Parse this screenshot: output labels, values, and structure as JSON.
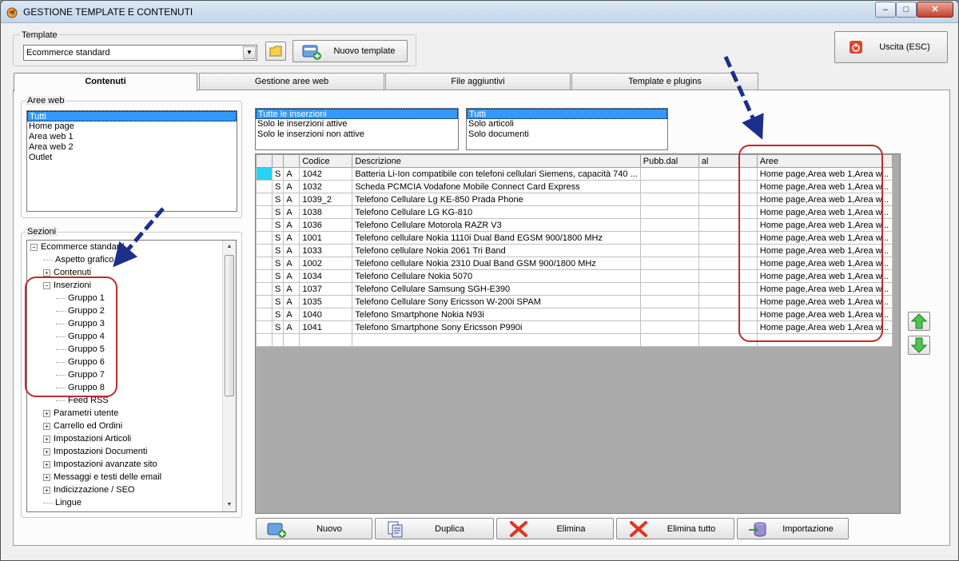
{
  "window": {
    "title": "GESTIONE TEMPLATE E CONTENUTI",
    "min": "–",
    "max": "□",
    "close": "✕"
  },
  "template": {
    "label": "Template",
    "selected": "Ecommerce standard",
    "new_template_button": "Nuovo template"
  },
  "exit_button": "Uscita (ESC)",
  "tabs": [
    {
      "label": "Contenuti"
    },
    {
      "label": "Gestione aree web"
    },
    {
      "label": "File aggiuntivi"
    },
    {
      "label": "Template e plugins"
    }
  ],
  "areas": {
    "label": "Aree web",
    "items": [
      "Tutti",
      "Home page",
      "Area web 1",
      "Area web 2",
      "Outlet"
    ]
  },
  "sections": {
    "label": "Sezioni",
    "tree": [
      {
        "text": "Ecommerce standard",
        "level": 0,
        "exp": "−"
      },
      {
        "text": "Aspetto grafico",
        "level": 1,
        "exp": ""
      },
      {
        "text": "Contenuti",
        "level": 1,
        "exp": "+"
      },
      {
        "text": "Inserzioni",
        "level": 1,
        "exp": "−"
      },
      {
        "text": "Gruppo 1",
        "level": 2,
        "exp": ""
      },
      {
        "text": "Gruppo 2",
        "level": 2,
        "exp": ""
      },
      {
        "text": "Gruppo 3",
        "level": 2,
        "exp": ""
      },
      {
        "text": "Gruppo 4",
        "level": 2,
        "exp": ""
      },
      {
        "text": "Gruppo 5",
        "level": 2,
        "exp": ""
      },
      {
        "text": "Gruppo 6",
        "level": 2,
        "exp": ""
      },
      {
        "text": "Gruppo 7",
        "level": 2,
        "exp": ""
      },
      {
        "text": "Gruppo 8",
        "level": 2,
        "exp": ""
      },
      {
        "text": "Feed RSS",
        "level": 2,
        "exp": ""
      },
      {
        "text": "Parametri utente",
        "level": 1,
        "exp": "+"
      },
      {
        "text": "Carrello ed Ordini",
        "level": 1,
        "exp": "+"
      },
      {
        "text": "Impostazioni Articoli",
        "level": 1,
        "exp": "+"
      },
      {
        "text": "Impostazioni Documenti",
        "level": 1,
        "exp": "+"
      },
      {
        "text": "Impostazioni avanzate sito",
        "level": 1,
        "exp": "+"
      },
      {
        "text": "Messaggi e testi delle email",
        "level": 1,
        "exp": "+"
      },
      {
        "text": "Indicizzazione / SEO",
        "level": 1,
        "exp": "+"
      },
      {
        "text": "Lingue",
        "level": 1,
        "exp": ""
      }
    ]
  },
  "filter_status": {
    "items": [
      "Tutte le inserzioni",
      "Solo le inserzioni attive",
      "Solo le inserzioni non attive"
    ]
  },
  "filter_type": {
    "items": [
      "Tutti",
      "Solo articoli",
      "Solo documenti"
    ]
  },
  "grid": {
    "headers": [
      "",
      "",
      "",
      "Codice",
      "Descrizione",
      "Pubb.dal",
      "al",
      "Aree"
    ],
    "rows": [
      {
        "s": "S",
        "a": "A",
        "code": "1042",
        "desc": "Batteria Li-Ion compatibile con telefoni cellulari Siemens, capacità 740 ...",
        "from": "",
        "to": "",
        "areas": "Home page,Area web 1,Area w..."
      },
      {
        "s": "S",
        "a": "A",
        "code": "1032",
        "desc": "Scheda PCMCIA Vodafone Mobile Connect Card Express",
        "from": "",
        "to": "",
        "areas": "Home page,Area web 1,Area w..."
      },
      {
        "s": "S",
        "a": "A",
        "code": "1039_2",
        "desc": "Telefono Cellulare Lg KE-850 Prada Phone",
        "from": "",
        "to": "",
        "areas": "Home page,Area web 1,Area w..."
      },
      {
        "s": "S",
        "a": "A",
        "code": "1038",
        "desc": "Telefono Cellulare LG KG-810",
        "from": "",
        "to": "",
        "areas": "Home page,Area web 1,Area w..."
      },
      {
        "s": "S",
        "a": "A",
        "code": "1036",
        "desc": "Telefono Cellulare Motorola RAZR V3",
        "from": "",
        "to": "",
        "areas": "Home page,Area web 1,Area w..."
      },
      {
        "s": "S",
        "a": "A",
        "code": "1001",
        "desc": "Telefono cellulare Nokia 1110i Dual Band EGSM 900/1800 MHz",
        "from": "",
        "to": "",
        "areas": "Home page,Area web 1,Area w..."
      },
      {
        "s": "S",
        "a": "A",
        "code": "1033",
        "desc": "Telefono cellulare Nokia 2061 Tri Band",
        "from": "",
        "to": "",
        "areas": "Home page,Area web 1,Area w..."
      },
      {
        "s": "S",
        "a": "A",
        "code": "1002",
        "desc": "Telefono cellulare Nokia 2310 Dual Band GSM 900/1800 MHz",
        "from": "",
        "to": "",
        "areas": "Home page,Area web 1,Area w..."
      },
      {
        "s": "S",
        "a": "A",
        "code": "1034",
        "desc": "Telefono Cellulare Nokia 5070",
        "from": "",
        "to": "",
        "areas": "Home page,Area web 1,Area w..."
      },
      {
        "s": "S",
        "a": "A",
        "code": "1037",
        "desc": "Telefono Cellulare Samsung SGH-E390",
        "from": "",
        "to": "",
        "areas": "Home page,Area web 1,Area w..."
      },
      {
        "s": "S",
        "a": "A",
        "code": "1035",
        "desc": "Telefono Cellulare Sony Ericsson W-200i SPAM",
        "from": "",
        "to": "",
        "areas": "Home page,Area web 1,Area w..."
      },
      {
        "s": "S",
        "a": "A",
        "code": "1040",
        "desc": "Telefono Smartphone Nokia N93i",
        "from": "",
        "to": "",
        "areas": "Home page,Area web 1,Area w..."
      },
      {
        "s": "S",
        "a": "A",
        "code": "1041",
        "desc": "Telefono Smartphone Sony Ericsson P990i",
        "from": "",
        "to": "",
        "areas": "Home page,Area web 1,Area w..."
      }
    ]
  },
  "bottom_buttons": [
    {
      "label": "Nuovo",
      "icon": "new-item-icon"
    },
    {
      "label": "Duplica",
      "icon": "duplicate-icon"
    },
    {
      "label": "Elimina",
      "icon": "delete-icon"
    },
    {
      "label": "Elimina tutto",
      "icon": "delete-all-icon"
    },
    {
      "label": "Importazione",
      "icon": "import-icon"
    }
  ],
  "colors": {
    "selection": "#3399ff",
    "annotation_red": "#c22a2a",
    "annotation_arrow": "#1c2f8a",
    "grid_bg": "#ababab"
  }
}
